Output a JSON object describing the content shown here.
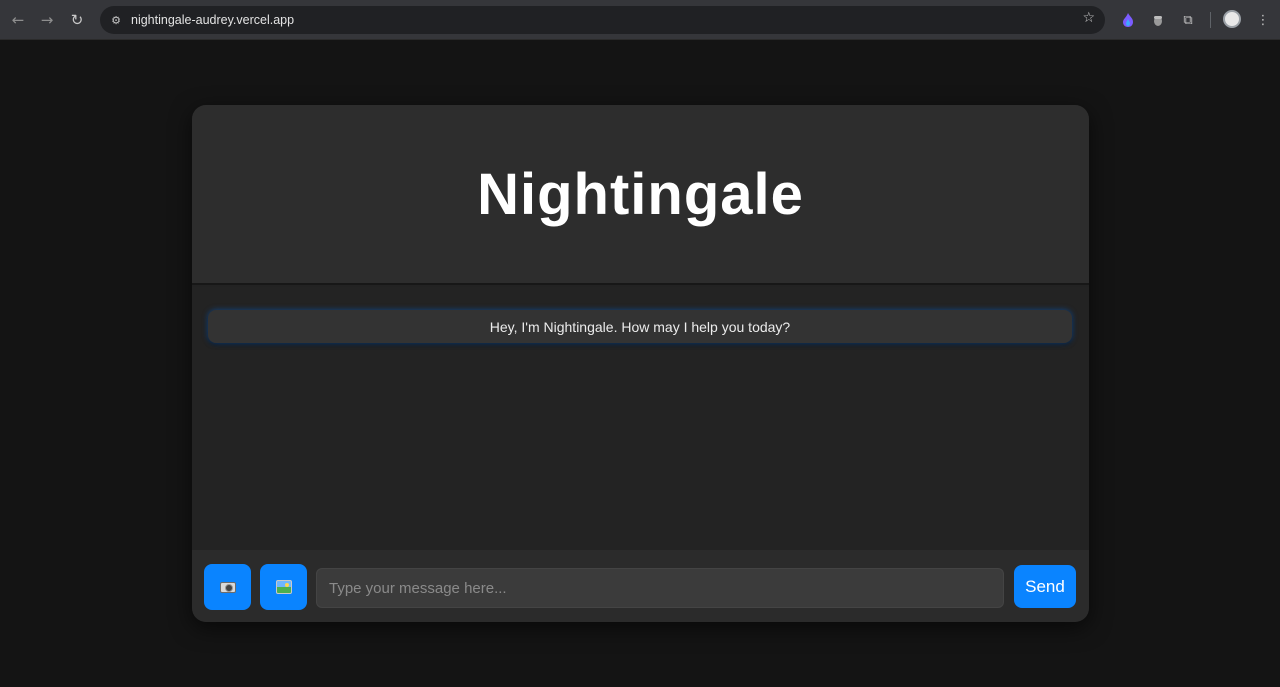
{
  "browser": {
    "url": "nightingale-audrey.vercel.app",
    "back_icon": "←",
    "forward_icon": "→",
    "reload_icon": "↻",
    "site_info_icon": "⚙",
    "bookmark_icon": "☆",
    "extensions_icon": "⧉",
    "menu_icon": "⋮"
  },
  "app": {
    "title": "Nightingale",
    "greeting": "Hey, I'm Nightingale. How may I help you today?",
    "input_placeholder": "Type your message here...",
    "input_value": "",
    "send_label": "Send",
    "camera_icon": "camera",
    "image_icon": "image",
    "accent_color": "#0a84ff"
  }
}
